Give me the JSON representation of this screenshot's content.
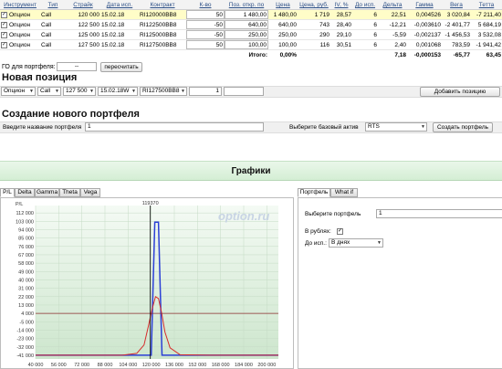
{
  "table": {
    "headers": [
      "Инструмент",
      "Тип",
      "Страйк",
      "Дата исп.",
      "Контракт",
      "К-во",
      "Поз. откр. по",
      "Цена",
      "Цена, руб.",
      "IV, %",
      "До исп.",
      "Дельта",
      "Гамма",
      "Вега",
      "Тетта"
    ],
    "rows": [
      {
        "instrument": "Опцион",
        "type": "Call",
        "strike": "120 000",
        "date": "15.02.18",
        "contract": "RI120000BB8",
        "qty": "50",
        "open": "1 480,00",
        "price": "1 480,00",
        "price_rub": "1 719",
        "iv": "28,57",
        "days": "6",
        "delta": "22,51",
        "gamma": "0,004526",
        "vega": "3 020,84",
        "theta": "-7 211,40",
        "selected": true
      },
      {
        "instrument": "Опцион",
        "type": "Call",
        "strike": "122 500",
        "date": "15.02.18",
        "contract": "RI122500BB8",
        "qty": "-50",
        "open": "640,00",
        "price": "640,00",
        "price_rub": "743",
        "iv": "28,40",
        "days": "6",
        "delta": "-12,21",
        "gamma": "-0,003610",
        "vega": "-2 401,77",
        "theta": "5 684,19",
        "selected": false
      },
      {
        "instrument": "Опцион",
        "type": "Call",
        "strike": "125 000",
        "date": "15.02.18",
        "contract": "RI125000BB8",
        "qty": "-50",
        "open": "250,00",
        "price": "250,00",
        "price_rub": "290",
        "iv": "29,10",
        "days": "6",
        "delta": "-5,59",
        "gamma": "-0,002137",
        "vega": "-1 456,53",
        "theta": "3 532,08",
        "selected": false
      },
      {
        "instrument": "Опцион",
        "type": "Call",
        "strike": "127 500",
        "date": "15.02.18",
        "contract": "RI127500BB8",
        "qty": "50",
        "open": "100,00",
        "price": "100,00",
        "price_rub": "116",
        "iv": "30,51",
        "days": "6",
        "delta": "2,40",
        "gamma": "0,001068",
        "vega": "783,59",
        "theta": "-1 941,42",
        "selected": false
      }
    ],
    "totals": {
      "label": "Итого:",
      "pct": "0,00%",
      "delta": "7,18",
      "gamma": "-0,000153",
      "vega": "-65,77",
      "theta": "63,45"
    }
  },
  "go": {
    "label": "ГО для портфеля:",
    "value": "--",
    "recalc_label": "пересчитать"
  },
  "new_position": {
    "title": "Новая позиция",
    "instrument": "Опцион",
    "type": "Call",
    "strike": "127 500",
    "date": "15.02.18W",
    "contract": "RI127500BB8",
    "qty": "1",
    "add_label": "Добавить позицию"
  },
  "new_portfolio": {
    "title": "Создание нового портфеля",
    "name_placeholder": "Введите название портфеля",
    "name_value": "1",
    "asset_label": "Выберите базовый актив",
    "asset_value": "RTS",
    "create_label": "Создать портфель"
  },
  "graphs": {
    "title": "Графики",
    "tabs": [
      "P/L",
      "Delta",
      "Gamma",
      "Theta",
      "Vega"
    ],
    "active_tab": "P/L"
  },
  "side": {
    "tabs": [
      "Портфель",
      "What if"
    ],
    "choose_label": "Выберите портфель",
    "portfolio_value": "1",
    "rub_label": "В рублях:",
    "to_exp_label": "До исп.:",
    "to_exp_value": "В днях"
  },
  "chart_data": {
    "type": "line",
    "y_title": "P/L",
    "watermark": "option.ru",
    "current_price_label": "119370",
    "current_price": 119370,
    "xlim": [
      40000,
      208000
    ],
    "ylim": [
      -45000,
      120000
    ],
    "x_ticks": [
      "40 000",
      "56 000",
      "72 000",
      "88 000",
      "104 000",
      "120 000",
      "136 000",
      "152 000",
      "168 000",
      "184 000",
      "200 000"
    ],
    "x_tick_values": [
      40000,
      56000,
      72000,
      88000,
      104000,
      120000,
      136000,
      152000,
      168000,
      184000,
      200000
    ],
    "y_ticks": [
      "112 000",
      "103 000",
      "94 000",
      "85 000",
      "76 000",
      "67 000",
      "58 000",
      "49 000",
      "40 000",
      "31 000",
      "22 000",
      "13 000",
      "4 000",
      "-5 000",
      "-14 000",
      "-23 000",
      "-32 000",
      "-41 000"
    ],
    "y_tick_values": [
      112000,
      103000,
      94000,
      85000,
      76000,
      67000,
      58000,
      49000,
      40000,
      31000,
      22000,
      13000,
      4000,
      -5000,
      -14000,
      -23000,
      -32000,
      -41000
    ],
    "grid": true,
    "series": [
      {
        "color": "#2b3fd6",
        "x": [
          40000,
          119000,
          120000,
          122500,
          123500,
          125000,
          127500,
          208000
        ],
        "y": [
          -41000,
          -41000,
          -41000,
          102000,
          102000,
          102000,
          -41000,
          -41000
        ]
      },
      {
        "color": "#d62b2b",
        "x": [
          40000,
          100000,
          110000,
          115000,
          118000,
          120500,
          123000,
          125000,
          127000,
          129500,
          133000,
          140000,
          160000,
          208000
        ],
        "y": [
          -41000,
          -41000,
          -39000,
          -30000,
          -10000,
          8000,
          22000,
          20000,
          6000,
          -16000,
          -33000,
          -40500,
          -41000,
          -41000
        ]
      },
      {
        "color": "#8a2b2b",
        "x": [
          40000,
          208000
        ],
        "y": [
          4000,
          4000
        ]
      }
    ]
  }
}
